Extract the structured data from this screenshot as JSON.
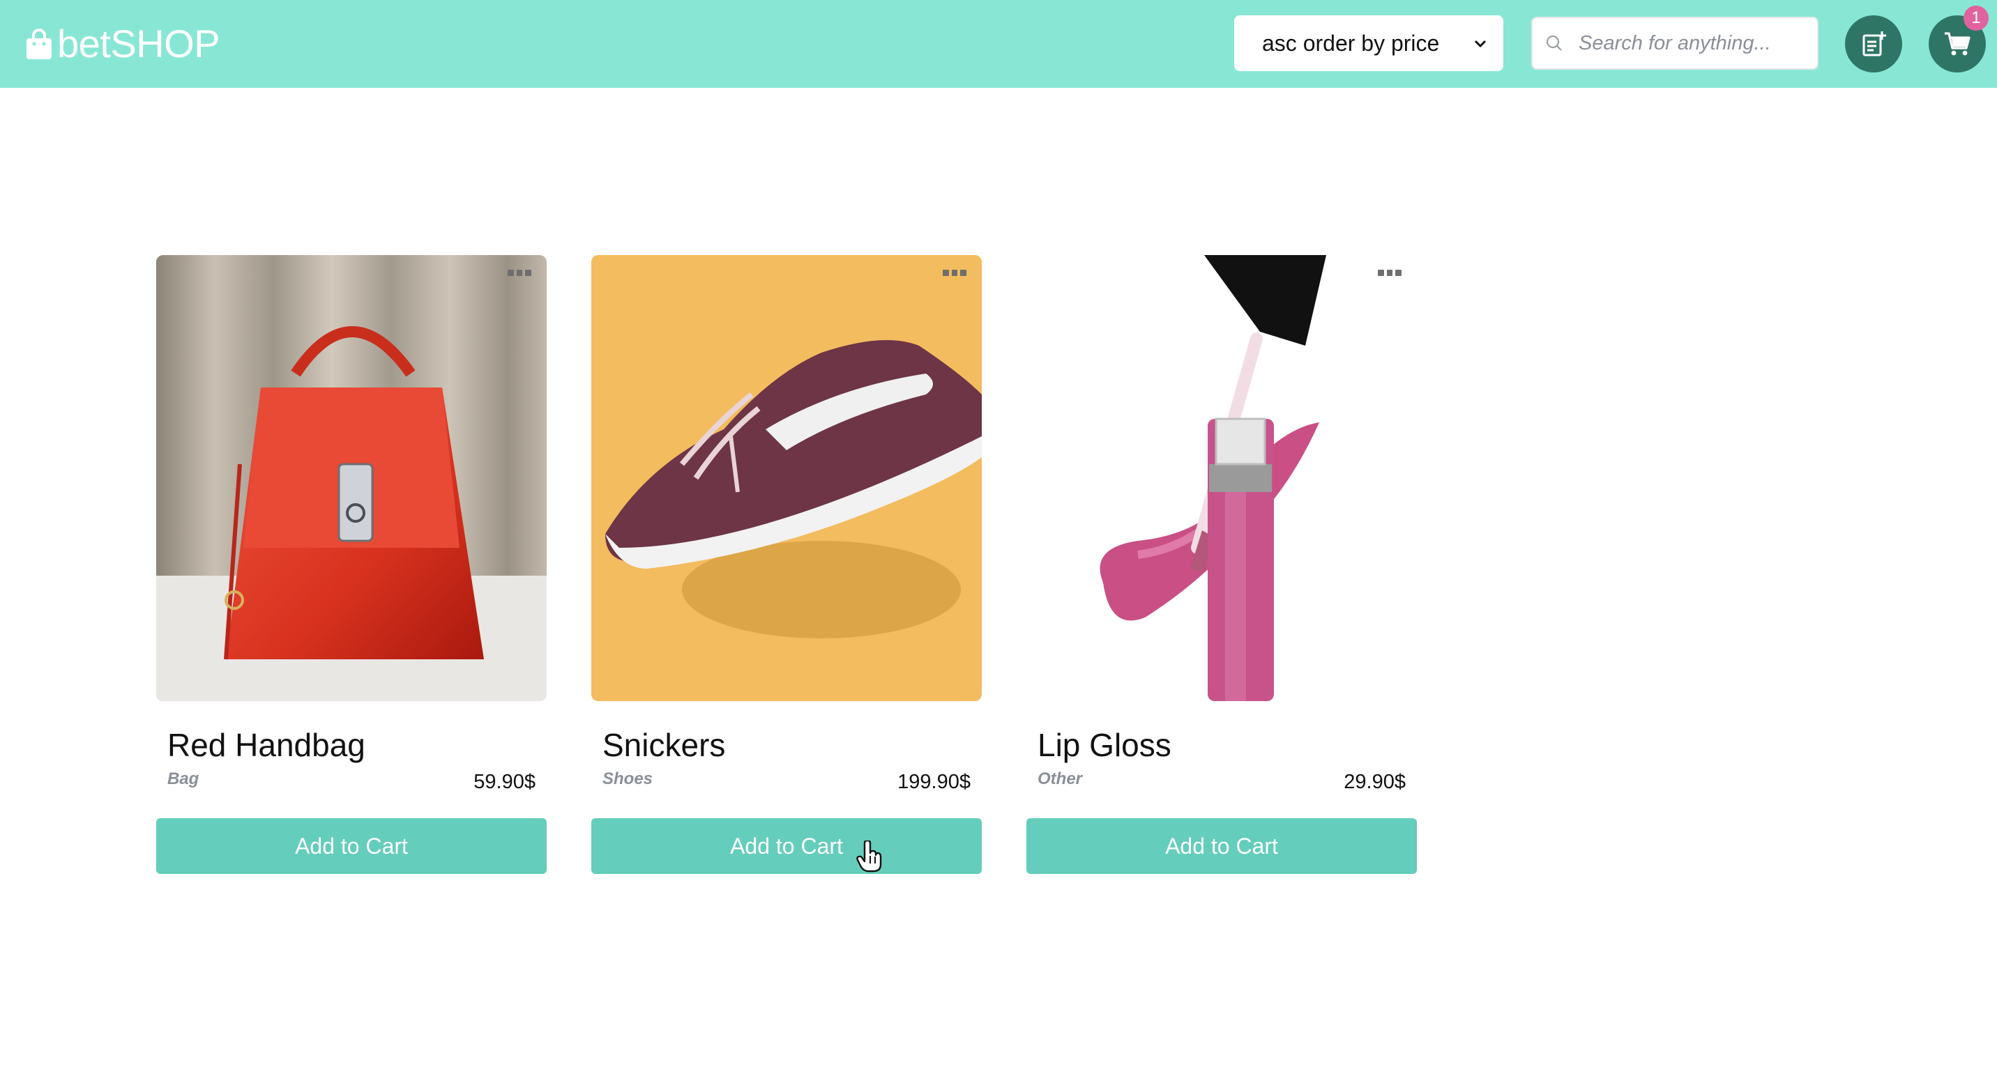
{
  "header": {
    "brand": "betSHOP",
    "sort_select": {
      "selected": "asc order by price"
    },
    "search": {
      "placeholder": "Search for anything...",
      "value": ""
    },
    "cart_count": "1"
  },
  "products": [
    {
      "name": "Red Handbag",
      "category": "Bag",
      "price": "59.90$",
      "button_label": "Add to Cart",
      "image": "red-handbag"
    },
    {
      "name": "Snickers",
      "category": "Shoes",
      "price": "199.90$",
      "button_label": "Add to Cart",
      "image": "sneaker"
    },
    {
      "name": "Lip Gloss",
      "category": "Other",
      "price": "29.90$",
      "button_label": "Add to Cart",
      "image": "lip-gloss"
    }
  ],
  "colors": {
    "header_bg": "#88e7d4",
    "button_bg": "#64cdbb",
    "icon_button_bg": "#2f7566",
    "badge_bg": "#e0629f"
  },
  "icons": [
    "shopping-bag-icon",
    "chevron-down-icon",
    "search-icon",
    "add-product-icon",
    "cart-icon",
    "more-icon",
    "hand-pointer-cursor"
  ]
}
